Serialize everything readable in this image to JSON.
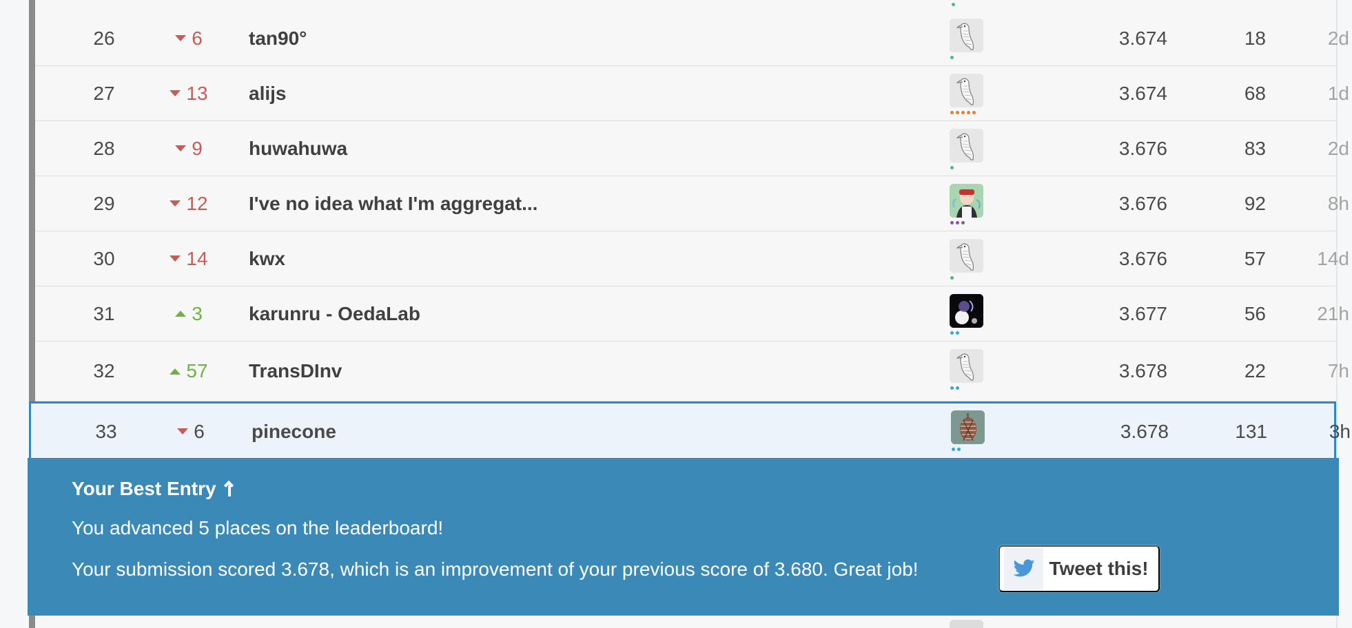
{
  "leaderboard": {
    "rows": [
      {
        "rank": "26",
        "change_direction": "down",
        "change": "6",
        "team": "tan90°",
        "avatar_icon": "goose-avatar-icon",
        "badge_dots": [
          "green"
        ],
        "score": "3.674",
        "entries": "18",
        "last": "2d"
      },
      {
        "rank": "27",
        "change_direction": "down",
        "change": "13",
        "team": "alijs",
        "avatar_icon": "goose-avatar-icon",
        "badge_dots": [
          "orange",
          "orange",
          "orange",
          "orange",
          "orange"
        ],
        "score": "3.674",
        "entries": "68",
        "last": "1d"
      },
      {
        "rank": "28",
        "change_direction": "down",
        "change": "9",
        "team": "huwahuwa",
        "avatar_icon": "goose-avatar-icon",
        "badge_dots": [
          "green"
        ],
        "score": "3.676",
        "entries": "83",
        "last": "2d"
      },
      {
        "rank": "29",
        "change_direction": "down",
        "change": "12",
        "team": "I've no idea what I'm aggregat...",
        "avatar_icon": "portrait-avatar-icon",
        "badge_dots": [
          "purple",
          "purple",
          "purple"
        ],
        "score": "3.676",
        "entries": "92",
        "last": "8h"
      },
      {
        "rank": "30",
        "change_direction": "down",
        "change": "14",
        "team": "kwx",
        "avatar_icon": "goose-avatar-icon",
        "badge_dots": [
          "green"
        ],
        "score": "3.676",
        "entries": "57",
        "last": "14d"
      },
      {
        "rank": "31",
        "change_direction": "up",
        "change": "3",
        "team": "karunru - OedaLab",
        "avatar_icon": "dark-light-avatar-icon",
        "badge_dots": [
          "blue",
          "blue"
        ],
        "score": "3.677",
        "entries": "56",
        "last": "21h"
      },
      {
        "rank": "32",
        "change_direction": "up",
        "change": "57",
        "team": "TransDInv",
        "avatar_icon": "goose-avatar-icon",
        "badge_dots": [
          "blue",
          "blue"
        ],
        "score": "3.678",
        "entries": "22",
        "last": "7h"
      }
    ],
    "highlighted_row": {
      "rank": "33",
      "change_direction": "down",
      "change": "6",
      "team": "pinecone",
      "avatar_icon": "pinecone-avatar-icon",
      "badge_dots": [
        "blue",
        "blue"
      ],
      "score": "3.678",
      "entries": "131",
      "last": "3h"
    }
  },
  "best_entry_banner": {
    "title": "Your Best Entry",
    "title_icon": "arrow-up-icon",
    "advanced_text": "You advanced 5 places on the leaderboard!",
    "score_text": "Your submission scored 3.678, which is an improvement of your previous score of 3.680. Great job!",
    "tweet_button_label": "Tweet this!",
    "tweet_icon": "twitter-icon"
  },
  "colors": {
    "accent_blue": "#3a89b7",
    "highlight_border": "#2f88c4",
    "down_red": "#c85b55",
    "up_green": "#6fb146",
    "muted_text": "#a3a3a3"
  }
}
